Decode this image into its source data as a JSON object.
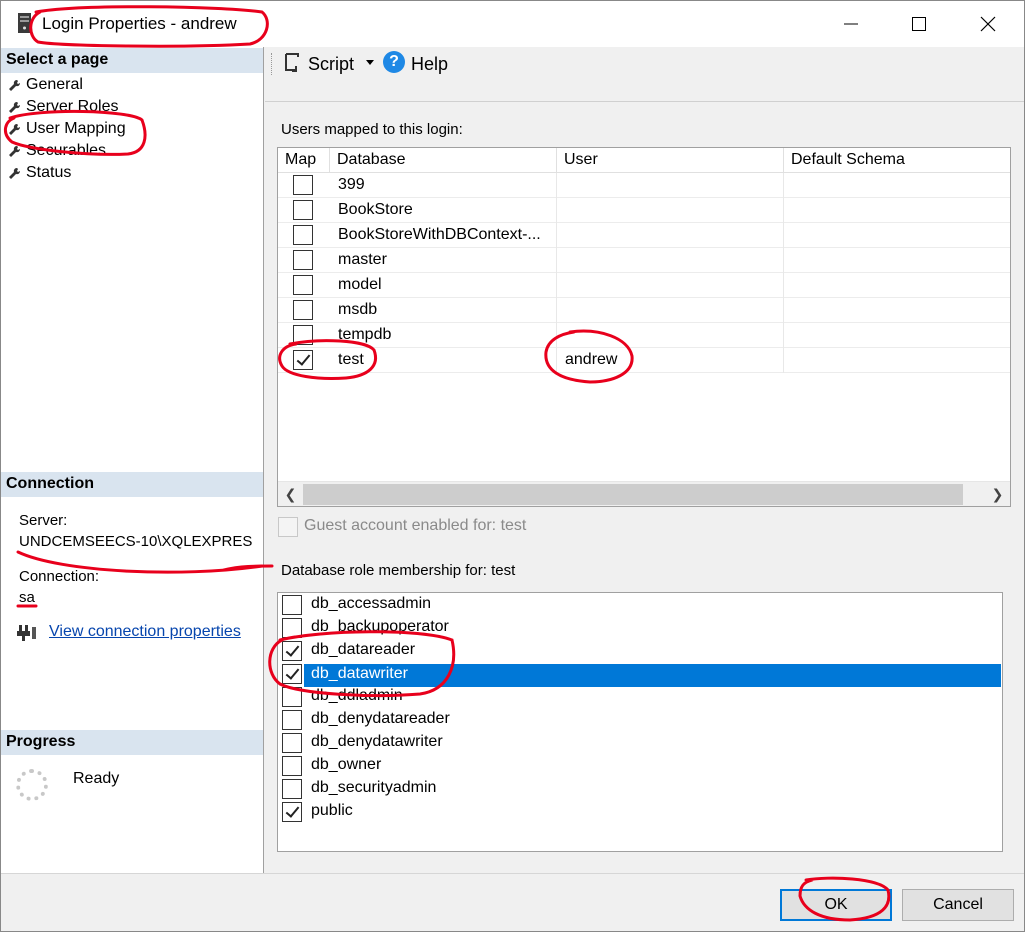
{
  "window": {
    "title": "Login Properties - andrew",
    "icon": "server-icon",
    "controls": [
      "minimize-icon",
      "maximize-icon",
      "close-icon"
    ]
  },
  "select_page": {
    "header": "Select a page",
    "items": [
      {
        "label": "General",
        "icon": "wrench-icon"
      },
      {
        "label": "Server Roles",
        "icon": "wrench-icon"
      },
      {
        "label": "User Mapping",
        "icon": "wrench-icon",
        "selected": true
      },
      {
        "label": "Securables",
        "icon": "wrench-icon"
      },
      {
        "label": "Status",
        "icon": "wrench-icon"
      }
    ]
  },
  "connection": {
    "header": "Connection",
    "server_label": "Server:",
    "server_value": "UNDCEMSEECS-10\\XQLEXPRES",
    "connection_label": "Connection:",
    "connection_value": "sa",
    "view_link": "View connection properties"
  },
  "progress": {
    "header": "Progress",
    "status": "Ready"
  },
  "toolbar": {
    "script_label": "Script",
    "help_label": "Help"
  },
  "users_mapped": {
    "label": "Users mapped to this login:",
    "columns": [
      "Map",
      "Database",
      "User",
      "Default Schema"
    ],
    "rows": [
      {
        "map": false,
        "database": "399",
        "user": "",
        "schema": ""
      },
      {
        "map": false,
        "database": "BookStore",
        "user": "",
        "schema": ""
      },
      {
        "map": false,
        "database": "BookStoreWithDBContext-...",
        "user": "",
        "schema": ""
      },
      {
        "map": false,
        "database": "master",
        "user": "",
        "schema": ""
      },
      {
        "map": false,
        "database": "model",
        "user": "",
        "schema": ""
      },
      {
        "map": false,
        "database": "msdb",
        "user": "",
        "schema": ""
      },
      {
        "map": false,
        "database": "tempdb",
        "user": "",
        "schema": ""
      },
      {
        "map": true,
        "database": "test",
        "user": "andrew",
        "schema": ""
      }
    ]
  },
  "guest": {
    "label": "Guest account enabled for: test",
    "enabled": false
  },
  "roles": {
    "label": "Database role membership for: test",
    "items": [
      {
        "name": "db_accessadmin",
        "checked": false
      },
      {
        "name": "db_backupoperator",
        "checked": false
      },
      {
        "name": "db_datareader",
        "checked": true
      },
      {
        "name": "db_datawriter",
        "checked": true,
        "selected": true
      },
      {
        "name": "db_ddladmin",
        "checked": false
      },
      {
        "name": "db_denydatareader",
        "checked": false
      },
      {
        "name": "db_denydatawriter",
        "checked": false
      },
      {
        "name": "db_owner",
        "checked": false
      },
      {
        "name": "db_securityadmin",
        "checked": false
      },
      {
        "name": "public",
        "checked": true
      }
    ]
  },
  "footer": {
    "ok_label": "OK",
    "cancel_label": "Cancel"
  },
  "colors": {
    "selection": "#0078d7",
    "section_header": "#d9e4ef",
    "annotation": "#e8001c",
    "link": "#0645ad"
  }
}
